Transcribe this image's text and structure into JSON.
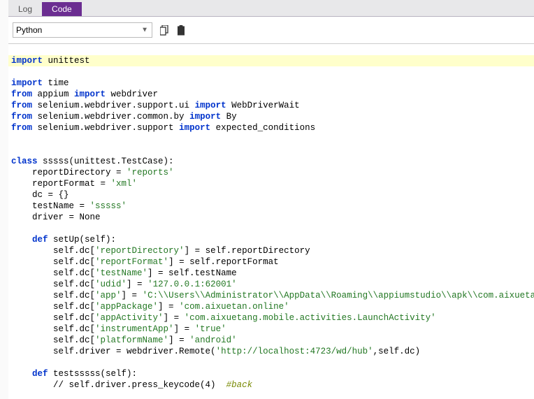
{
  "tabs": {
    "log": "Log",
    "code": "Code"
  },
  "toolbar": {
    "language": "Python",
    "clipboard_label": "Copy"
  },
  "code": {
    "l1_kw": "import",
    "l1_mod": " unittest",
    "l2_kw": "import",
    "l2_mod": " time",
    "l3_kw1": "from",
    "l3_mod1": " appium ",
    "l3_kw2": "import",
    "l3_mod2": " webdriver",
    "l4_kw1": "from",
    "l4_mod1": " selenium.webdriver.support.ui ",
    "l4_kw2": "import",
    "l4_mod2": " WebDriverWait",
    "l5_kw1": "from",
    "l5_mod1": " selenium.webdriver.common.by ",
    "l5_kw2": "import",
    "l5_mod2": " By",
    "l6_kw1": "from",
    "l6_mod1": " selenium.webdriver.support ",
    "l6_kw2": "import",
    "l6_mod2": " expected_conditions",
    "blank": " ",
    "l8_kw": "class",
    "l8_txt": " sssss(unittest.TestCase):",
    "l9_txt": "    reportDirectory = ",
    "l9_str": "'reports'",
    "l10_txt": "    reportFormat = ",
    "l10_str": "'xml'",
    "l11_txt": "    dc = {}",
    "l12_txt": "    testName = ",
    "l12_str": "'sssss'",
    "l13_txt": "    driver = None",
    "l15_ind": "    ",
    "l15_kw": "def",
    "l15_txt": " setUp(self):",
    "l16_txt": "        self.dc[",
    "l16_str": "'reportDirectory'",
    "l16_end": "] = self.reportDirectory",
    "l17_txt": "        self.dc[",
    "l17_str": "'reportFormat'",
    "l17_end": "] = self.reportFormat",
    "l18_txt": "        self.dc[",
    "l18_str": "'testName'",
    "l18_end": "] = self.testName",
    "l19_txt": "        self.dc[",
    "l19_str1": "'udid'",
    "l19_mid": "] = ",
    "l19_str2": "'127.0.0.1:62001'",
    "l20_txt": "        self.dc[",
    "l20_str1": "'app'",
    "l20_mid": "] = ",
    "l20_str2": "'C:\\\\Users\\\\Administrator\\\\AppData\\\\Roaming\\\\appiumstudio\\\\apk\\\\com.aixuetan.onli",
    "l21_txt": "        self.dc[",
    "l21_str1": "'appPackage'",
    "l21_mid": "] = ",
    "l21_str2": "'com.aixuetan.online'",
    "l22_txt": "        self.dc[",
    "l22_str1": "'appActivity'",
    "l22_mid": "] = ",
    "l22_str2": "'com.aixuetang.mobile.activities.LaunchActivity'",
    "l23_txt": "        self.dc[",
    "l23_str1": "'instrumentApp'",
    "l23_mid": "] = ",
    "l23_str2": "'true'",
    "l24_txt": "        self.dc[",
    "l24_str1": "'platformName'",
    "l24_mid": "] = ",
    "l24_str2": "'android'",
    "l25_txt": "        self.driver = webdriver.Remote(",
    "l25_str": "'http://localhost:4723/wd/hub'",
    "l25_end": ",self.dc)",
    "l27_ind": "    ",
    "l27_kw": "def",
    "l27_txt": " testsssss(self):",
    "l28_txt": "        // self.driver.press_keycode(4)  ",
    "l28_comment": "#back"
  }
}
